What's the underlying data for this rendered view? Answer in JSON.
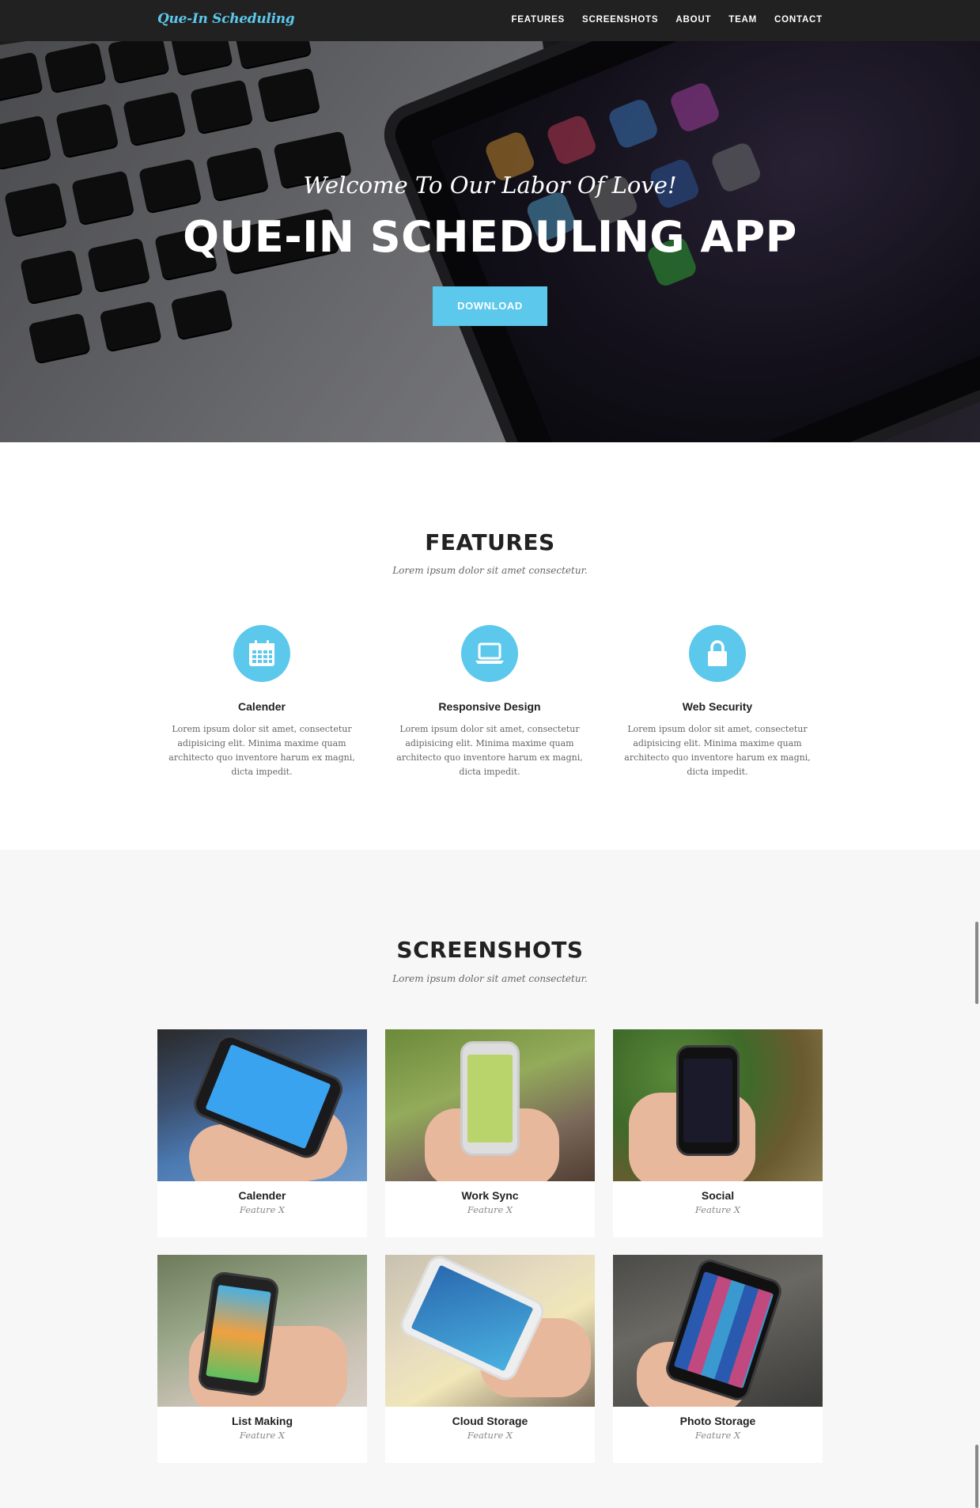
{
  "brand": "Que-In Scheduling",
  "nav": [
    {
      "label": "FEATURES"
    },
    {
      "label": "SCREENSHOTS"
    },
    {
      "label": "ABOUT"
    },
    {
      "label": "TEAM"
    },
    {
      "label": "CONTACT"
    }
  ],
  "hero": {
    "subtitle": "Welcome To Our Labor Of Love!",
    "title": "QUE-IN SCHEDULING APP",
    "button": "DOWNLOAD"
  },
  "features": {
    "title": "FEATURES",
    "subtitle": "Lorem ipsum dolor sit amet consectetur.",
    "items": [
      {
        "icon": "calendar-icon",
        "title": "Calender",
        "text": "Lorem ipsum dolor sit amet, consectetur adipisicing elit. Minima maxime quam architecto quo inventore harum ex magni, dicta impedit."
      },
      {
        "icon": "laptop-icon",
        "title": "Responsive Design",
        "text": "Lorem ipsum dolor sit amet, consectetur adipisicing elit. Minima maxime quam architecto quo inventore harum ex magni, dicta impedit."
      },
      {
        "icon": "lock-icon",
        "title": "Web Security",
        "text": "Lorem ipsum dolor sit amet, consectetur adipisicing elit. Minima maxime quam architecto quo inventore harum ex magni, dicta impedit."
      }
    ]
  },
  "screenshots": {
    "title": "SCREENSHOTS",
    "subtitle": "Lorem ipsum dolor sit amet consectetur.",
    "items": [
      {
        "title": "Calender",
        "caption": "Feature X"
      },
      {
        "title": "Work Sync",
        "caption": "Feature X"
      },
      {
        "title": "Social",
        "caption": "Feature X"
      },
      {
        "title": "List Making",
        "caption": "Feature X"
      },
      {
        "title": "Cloud Storage",
        "caption": "Feature X"
      },
      {
        "title": "Photo Storage",
        "caption": "Feature X"
      }
    ]
  },
  "colors": {
    "accent": "#5bc8ec",
    "nav_bg": "#212121",
    "section_alt_bg": "#f7f7f7"
  }
}
